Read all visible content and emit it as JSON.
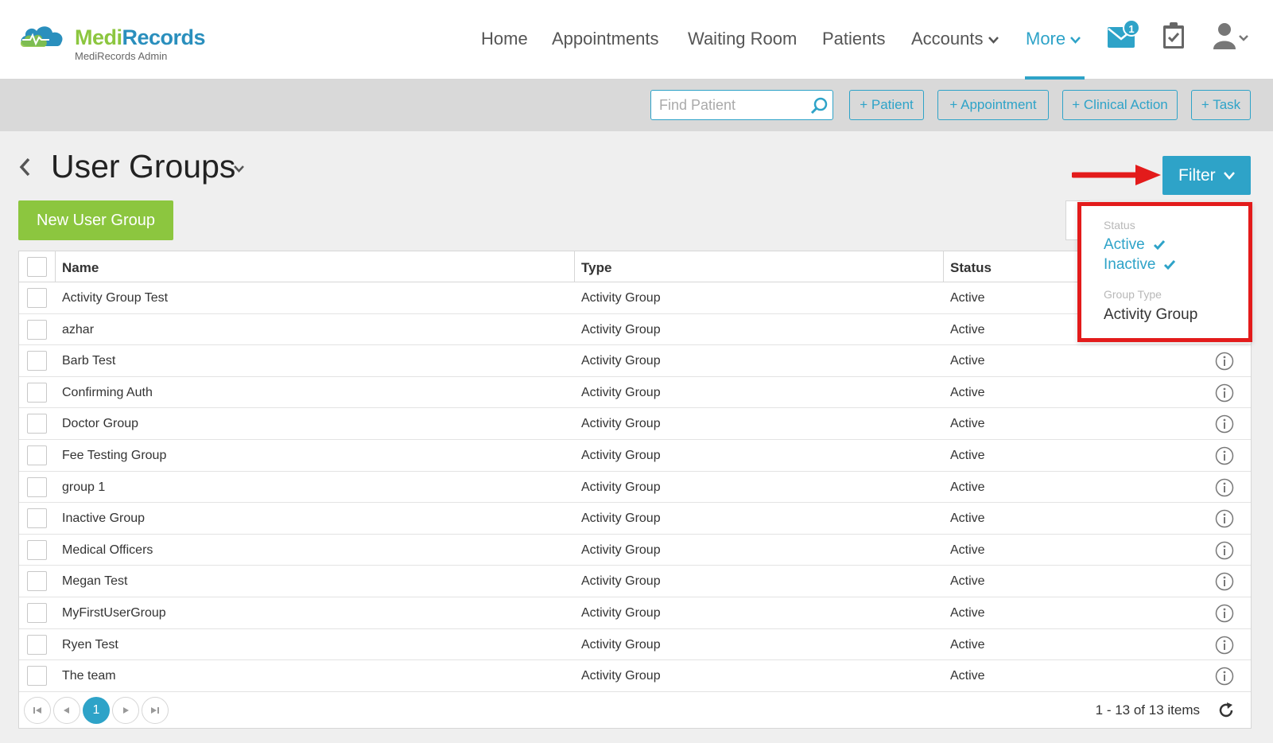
{
  "app": {
    "brand_part1": "Medi",
    "brand_part2": "Records",
    "brand_subtitle": "MediRecords Admin"
  },
  "nav": {
    "items": [
      {
        "label": "Home"
      },
      {
        "label": "Appointments"
      },
      {
        "label": "Waiting Room"
      },
      {
        "label": "Patients"
      },
      {
        "label": "Accounts"
      },
      {
        "label": "More"
      }
    ],
    "active_item": "More",
    "messages_badge": "1"
  },
  "actionbar": {
    "search_placeholder": "Find Patient",
    "add_patient": "+ Patient",
    "add_appointment": "+ Appointment",
    "add_clinical_action": "+ Clinical Action",
    "add_task": "+ Task"
  },
  "page": {
    "title": "User Groups",
    "filter_label": "Filter",
    "new_button": "New User Group"
  },
  "filter_panel": {
    "status_heading": "Status",
    "status_options": [
      "Active",
      "Inactive"
    ],
    "group_type_heading": "Group Type",
    "group_type_value": "Activity Group"
  },
  "table": {
    "columns": [
      "Name",
      "Type",
      "Status"
    ],
    "rows": [
      {
        "name": "Activity Group Test",
        "type": "Activity Group",
        "status": "Active"
      },
      {
        "name": "azhar",
        "type": "Activity Group",
        "status": "Active"
      },
      {
        "name": "Barb Test",
        "type": "Activity Group",
        "status": "Active"
      },
      {
        "name": "Confirming Auth",
        "type": "Activity Group",
        "status": "Active"
      },
      {
        "name": "Doctor Group",
        "type": "Activity Group",
        "status": "Active"
      },
      {
        "name": "Fee Testing Group",
        "type": "Activity Group",
        "status": "Active"
      },
      {
        "name": "group 1",
        "type": "Activity Group",
        "status": "Active"
      },
      {
        "name": "Inactive Group",
        "type": "Activity Group",
        "status": "Active"
      },
      {
        "name": "Medical Officers",
        "type": "Activity Group",
        "status": "Active"
      },
      {
        "name": "Megan Test",
        "type": "Activity Group",
        "status": "Active"
      },
      {
        "name": "MyFirstUserGroup",
        "type": "Activity Group",
        "status": "Active"
      },
      {
        "name": "Ryen Test",
        "type": "Activity Group",
        "status": "Active"
      },
      {
        "name": "The team",
        "type": "Activity Group",
        "status": "Active"
      }
    ]
  },
  "pager": {
    "current_page": "1",
    "info": "1 - 13 of 13 items"
  },
  "colors": {
    "accent": "#2ea3c8",
    "brand_green": "#8cc63f",
    "highlight_red": "#e31b1b"
  }
}
